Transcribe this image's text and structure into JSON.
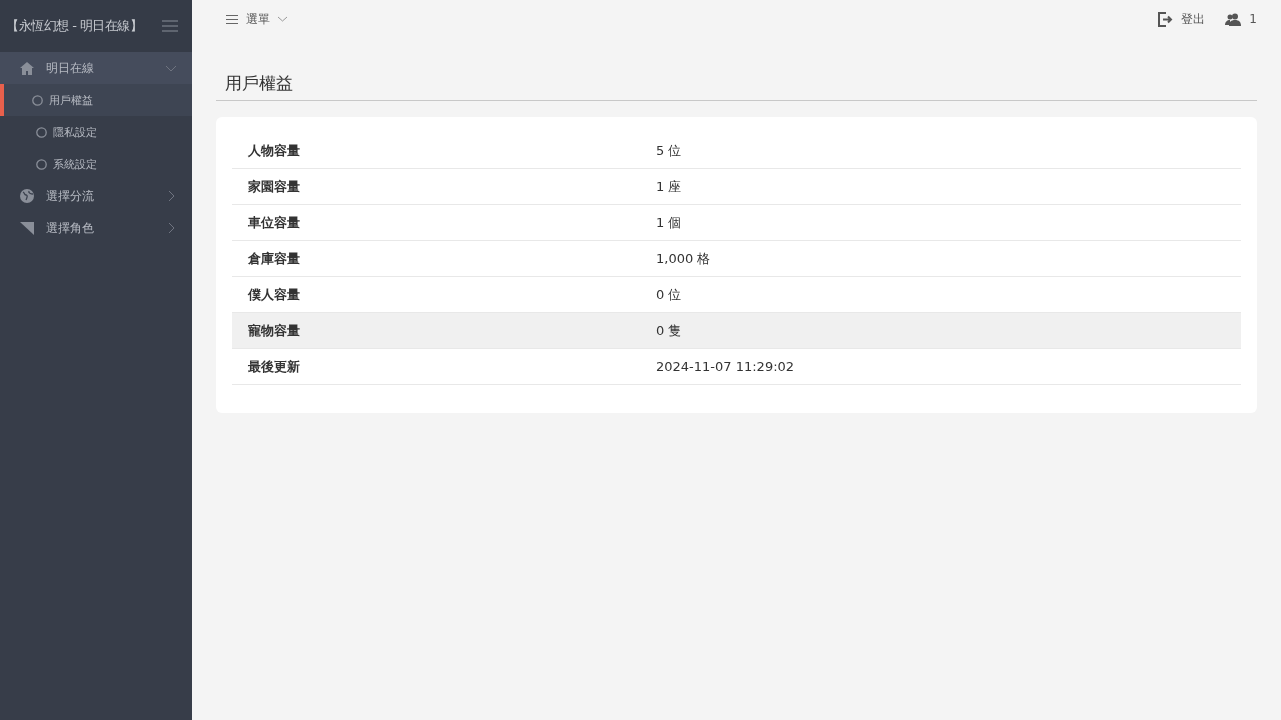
{
  "sidebar": {
    "title": "【永恆幻想 - 明日在線】",
    "items": [
      {
        "label": "明日在線",
        "expanded": true,
        "children": [
          {
            "label": "用戶權益",
            "selected": true
          },
          {
            "label": "隱私設定",
            "selected": false
          },
          {
            "label": "系統設定",
            "selected": false
          }
        ]
      },
      {
        "label": "選擇分流",
        "expanded": false
      },
      {
        "label": "選擇角色",
        "expanded": false
      }
    ]
  },
  "topbar": {
    "menu": "選單",
    "logout": "登出",
    "users": "1"
  },
  "page": {
    "title": "用戶權益",
    "rows": [
      {
        "label": "人物容量",
        "value": "5 位",
        "selected": false
      },
      {
        "label": "家園容量",
        "value": "1 座",
        "selected": false
      },
      {
        "label": "車位容量",
        "value": "1 個",
        "selected": false
      },
      {
        "label": "倉庫容量",
        "value": "1,000 格",
        "selected": false
      },
      {
        "label": "僕人容量",
        "value": "0 位",
        "selected": false
      },
      {
        "label": "寵物容量",
        "value": "0 隻",
        "selected": true
      },
      {
        "label": "最後更新",
        "value": "2024-11-07 11:29:02",
        "selected": false
      }
    ]
  }
}
